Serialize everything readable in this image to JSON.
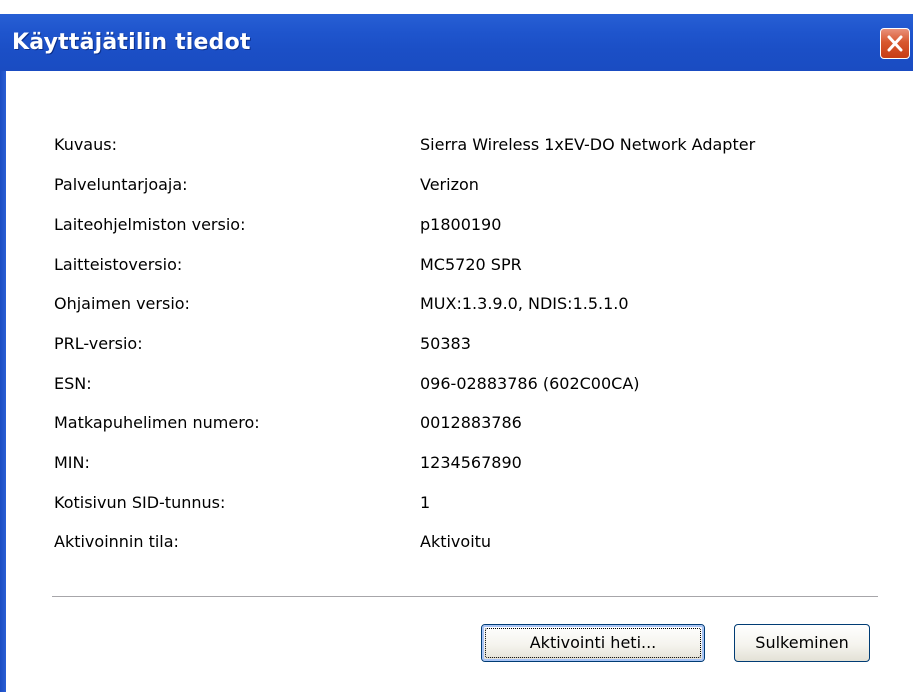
{
  "window": {
    "title": "Käyttäjätilin tiedot"
  },
  "colors": {
    "titlebar": "#1f55cd",
    "close_button": "#d8582f",
    "button_border": "#003c74"
  },
  "icons": {
    "close": "close-x-icon"
  },
  "details": [
    {
      "label": "Kuvaus:",
      "value": "Sierra Wireless 1xEV-DO Network Adapter"
    },
    {
      "label": "Palveluntarjoaja:",
      "value": "Verizon"
    },
    {
      "label": "Laiteohjelmiston versio:",
      "value": "p1800190"
    },
    {
      "label": "Laitteistoversio:",
      "value": "MC5720 SPR"
    },
    {
      "label": "Ohjaimen versio:",
      "value": "MUX:1.3.9.0, NDIS:1.5.1.0"
    },
    {
      "label": "PRL-versio:",
      "value": "50383"
    },
    {
      "label": "ESN:",
      "value": "096-02883786 (602C00CA)"
    },
    {
      "label": "Matkapuhelimen numero:",
      "value": "0012883786"
    },
    {
      "label": "MIN:",
      "value": "1234567890"
    },
    {
      "label": "Kotisivun SID-tunnus:",
      "value": "1"
    },
    {
      "label": "Aktivoinnin tila:",
      "value": "Aktivoitu"
    }
  ],
  "buttons": {
    "activate_mnemonic": "A",
    "activate_rest": "ktivointi heti...",
    "close_label": "Sulkeminen"
  }
}
